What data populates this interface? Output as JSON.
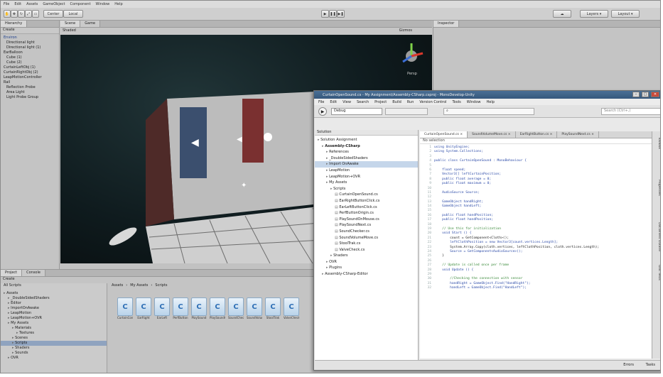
{
  "unity": {
    "menu": [
      "File",
      "Edit",
      "Assets",
      "GameObject",
      "Component",
      "Window",
      "Help"
    ],
    "toolbar": {
      "center_label": "Center",
      "local_label": "Local",
      "layers_label": "Layers",
      "layout_label": "Layout"
    },
    "hierarchy": {
      "tab": "Hierarchy",
      "create_label": "Create",
      "items": [
        "Environ",
        "Directional light",
        "Directional light (1)",
        "EarBalloon",
        "Cube (1)",
        "Cube (2)",
        "CurtainLeftObj (1)",
        "CurtainRightObj (2)",
        "LeapMotionController",
        "Rail",
        "Reflection Probe",
        "Area Light",
        "Light Probe Group"
      ]
    },
    "scene": {
      "tab_scene": "Scene",
      "tab_game": "Game",
      "shaded_label": "Shaded",
      "gizmos_label": "Gizmos",
      "persp_label": "Persp"
    },
    "inspector": {
      "tab": "Inspector"
    },
    "project": {
      "tab_project": "Project",
      "tab_console": "Console",
      "create_label": "Create",
      "favorites": "All Scripts",
      "tree": [
        "Assets",
        "_DoubleSidedShaders",
        "Editor",
        "ImportOnAwake",
        "LeapMotion",
        "LeapMotion+OVR",
        "My Assets",
        "Materials",
        "Textures",
        "Scenes",
        "Scripts",
        "Shaders",
        "Sounds",
        "OVR"
      ],
      "breadcrumb": [
        "Assets",
        "My Assets",
        "Scripts"
      ],
      "files": [
        "CurtainControl",
        "EarRight",
        "EarLeft",
        "PerfButton",
        "PlaySound",
        "PlaySoundOnMouse",
        "SoundChecker",
        "SoundVolume",
        "StoolTrak",
        "ValveCheck"
      ]
    }
  },
  "monodevelop": {
    "title": "CurtainOpenSound.cs - My Assignment/Assembly-CSharp.csproj - MonoDevelop-Unity",
    "menu": [
      "File",
      "Edit",
      "View",
      "Search",
      "Project",
      "Build",
      "Run",
      "Version Control",
      "Tools",
      "Window",
      "Help"
    ],
    "config_value": "Debug",
    "search_placeholder": "Search (Ctrl+,)",
    "solution": {
      "header": "Solution",
      "rows": [
        "Solution Assignment",
        "Assembly-CSharp",
        "References",
        "_DoubleSidedShaders",
        "Import OnAwake",
        "LeapMotion",
        "LeapMotion+OVR",
        "My Assets",
        "Scripts",
        "CurtainOpenSound.cs",
        "EarRightButtonClick.cs",
        "EarLeftButtonClick.cs",
        "PerfButtonOrigin.cs",
        "PlaySoundOnMouse.cs",
        "PlaySoundNext.cs",
        "SoundChecker.cs",
        "SoundVolumeMove.cs",
        "StoolTrak.cs",
        "ValveCheck.cs",
        "Shaders",
        "OVR",
        "Plugins",
        "Assembly-CSharp-Editor"
      ]
    },
    "editor": {
      "tabs": [
        "CurtainOpenSound.cs",
        "SoundVolumeMove.cs",
        "EarRightButton.cs",
        "PlaySoundNext.cs"
      ],
      "breadcrumb": "No selection",
      "lines": [
        "using UnityEngine;",
        "using System.Collections;",
        "",
        "public class CurtainOpenSound : MonoBehaviour {",
        "",
        "    float speed;",
        "    Vector3[] leftCurtainPosition;",
        "    public float average = 0;",
        "    public float maximum = 0;",
        "",
        "    AudioSource Source;",
        "",
        "    GameObject handRight;",
        "    GameObject handLeft;",
        "",
        "    public float handPosition;",
        "    public float handPosition;",
        "",
        "    // Use this for initialization",
        "    void Start () {",
        "        count = GetComponent<Cloth>();",
        "        leftClothPosition = new Vector3[count.vertices.Length];",
        "        System.Array.Copy(cloth.vertices, leftClothPosition, cloth.vertices.Length);",
        "        Source = GetComponent<AudioSource>();",
        "    }",
        "",
        "    // Update is called once per frame",
        "    void Update () {",
        "",
        "        //Checking the connection with sensor",
        "        handRight = GameObject.Find(\"HandRight\");",
        "        handLeft = GameObject.Find(\"HandLeft\");"
      ]
    },
    "side_tabs": [
      "Toolbox",
      "Properties",
      "Document Outline",
      "Unit Tests"
    ],
    "status": [
      "Errors",
      "Tasks"
    ]
  }
}
